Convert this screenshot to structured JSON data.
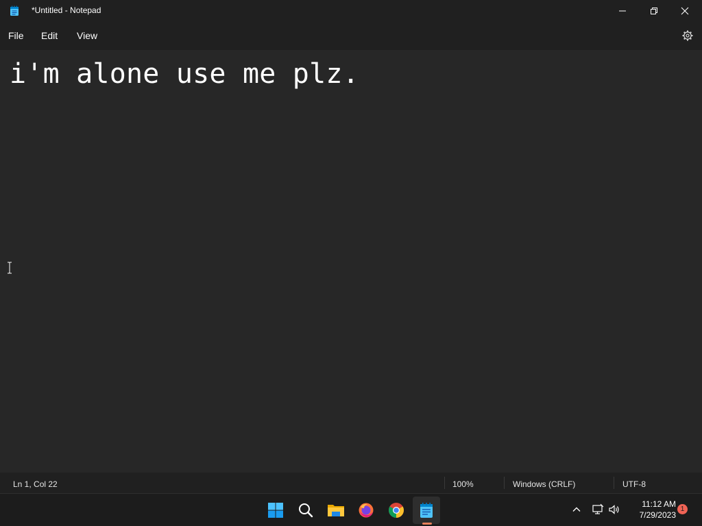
{
  "window": {
    "title": "*Untitled - Notepad",
    "icon": "notepad-icon"
  },
  "menu": {
    "file": "File",
    "edit": "Edit",
    "view": "View",
    "settings_icon": "gear-icon"
  },
  "editor": {
    "content": "i'm alone use me plz."
  },
  "status": {
    "position": "Ln 1, Col 22",
    "zoom": "100%",
    "line_endings": "Windows (CRLF)",
    "encoding": "UTF-8"
  },
  "taskbar": {
    "apps": [
      "windows-start-icon",
      "search-icon",
      "file-explorer-icon",
      "firefox-icon",
      "chrome-icon",
      "notepad-icon"
    ],
    "active_app": "notepad-icon",
    "time": "11:12 AM",
    "date": "7/29/2023",
    "notification_count": "1"
  },
  "colors": {
    "titlebar": "#202020",
    "editor_bg": "#272727",
    "taskbar": "#1c1c1c",
    "accent": "#e8805b",
    "badge": "#f06355"
  }
}
